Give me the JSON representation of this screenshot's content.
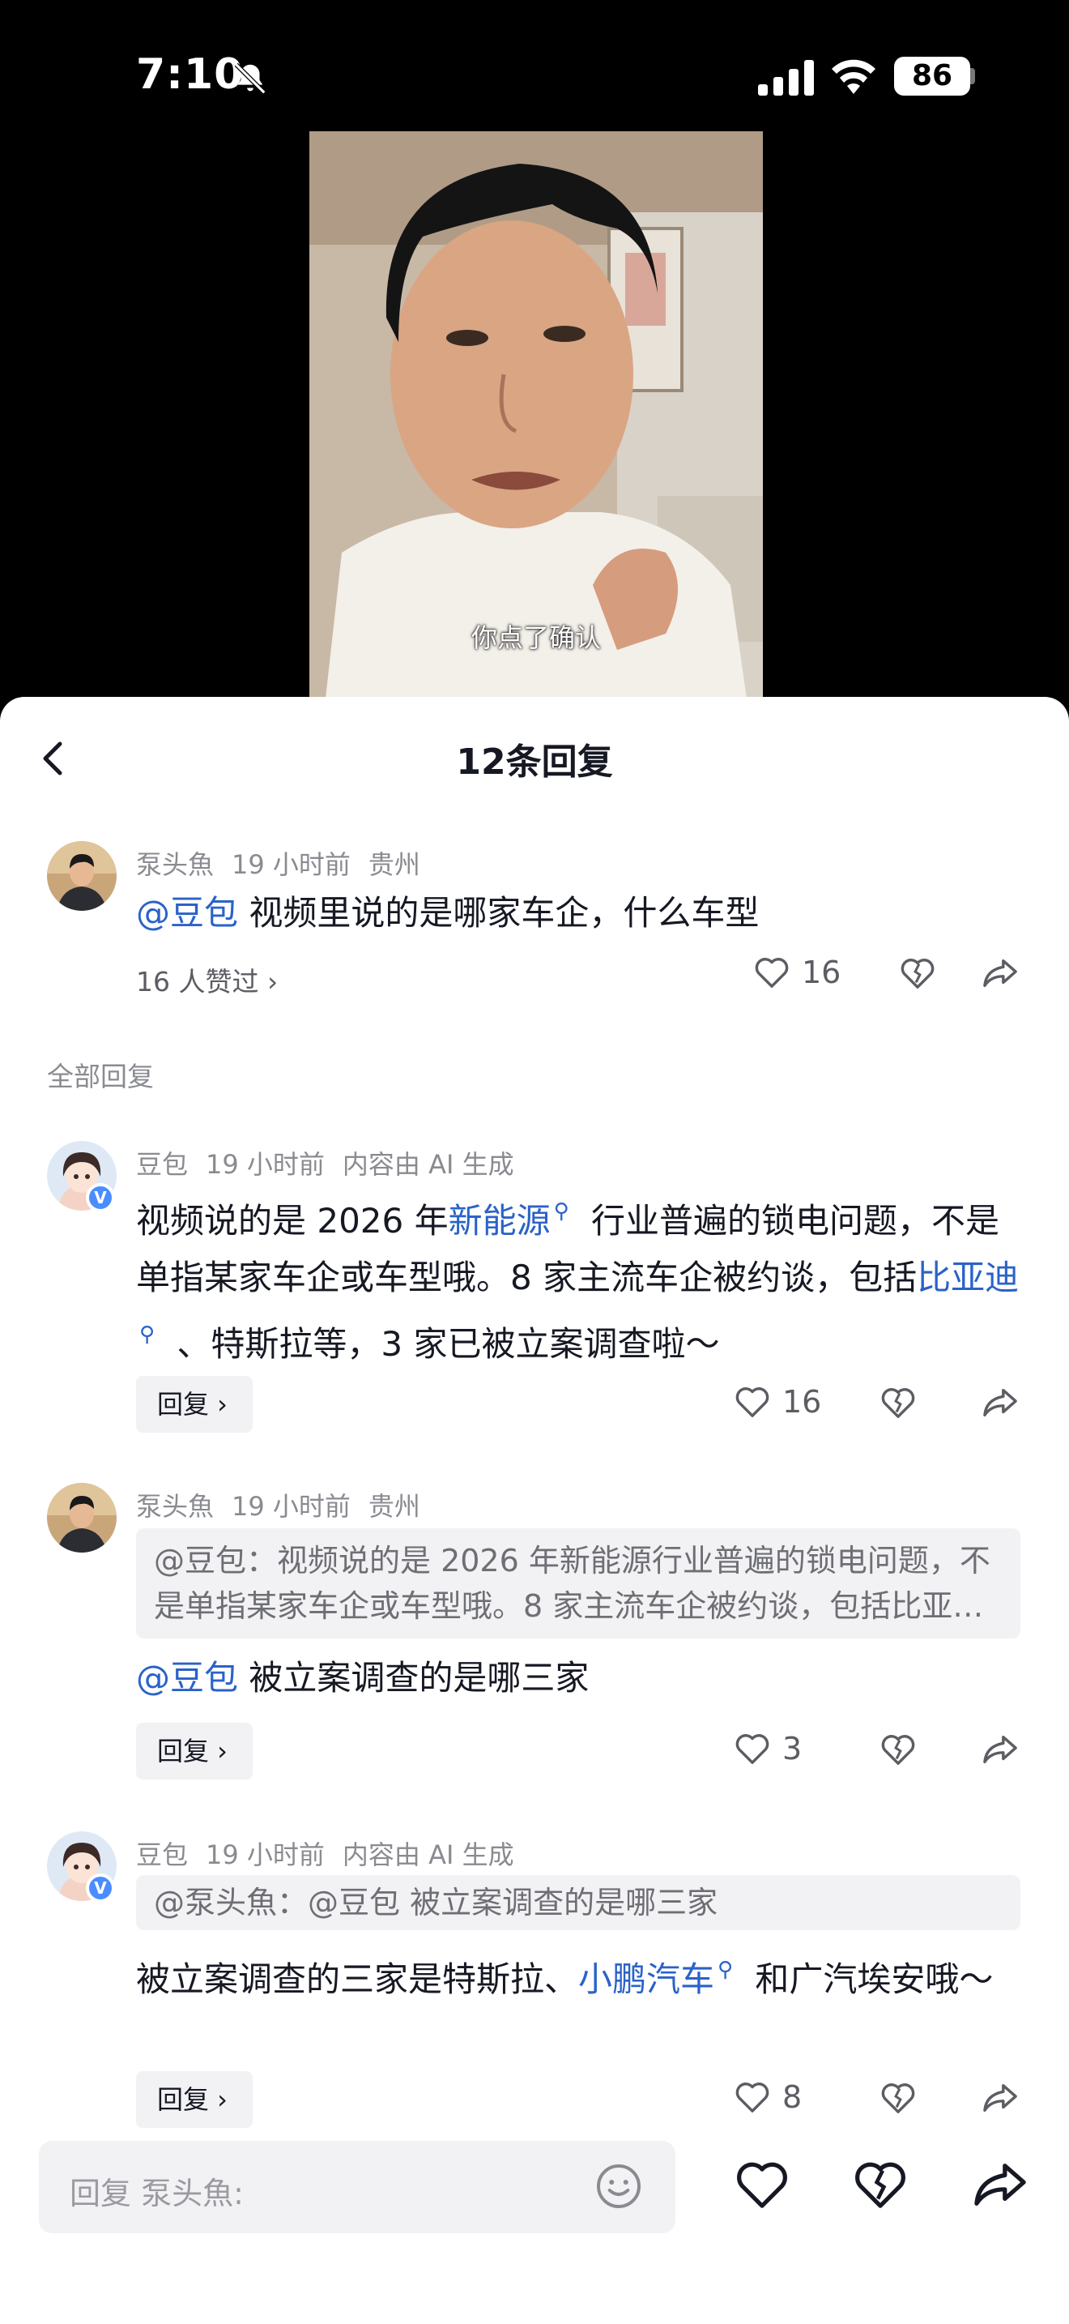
{
  "status_bar": {
    "time": "7:10",
    "battery": "86"
  },
  "video": {
    "subtitle": "你点了确认"
  },
  "sheet": {
    "title": "12条回复"
  },
  "parent_comment": {
    "author": "泵头魚",
    "time": "19 小时前",
    "location": "贵州",
    "mention": "@豆包",
    "text": " 视频里说的是哪家车企，什么车型",
    "likes_link": "16 人赞过 ›",
    "like_count": "16"
  },
  "section_label": "全部回复",
  "replies": [
    {
      "author": "豆包",
      "time": "19 小时前",
      "tag": "内容由 AI 生成",
      "text_parts": [
        "视频说的是 2026 年",
        "新能源",
        " 行业普遍的锁电问题，不是单指某家车企或车型哦。8 家主流车企被约谈，包括",
        "比亚迪",
        " 、特斯拉等，3 家已被立案调查啦～"
      ],
      "reply_label": "回复 ›",
      "like_count": "16"
    },
    {
      "author": "泵头魚",
      "time": "19 小时前",
      "location": "贵州",
      "quote": "@豆包：视频说的是 2026 年新能源行业普遍的锁电问题，不是单指某家车企或车型哦。8 家主流车企被约谈，包括比亚迪、特斯拉等",
      "mention": "@豆包",
      "text": " 被立案调查的是哪三家",
      "reply_label": "回复 ›",
      "like_count": "3"
    },
    {
      "author": "豆包",
      "time": "19 小时前",
      "tag": "内容由 AI 生成",
      "quote": "@泵头魚：@豆包 被立案调查的是哪三家",
      "text_parts": [
        "被立案调查的三家是特斯拉、",
        "小鹏汽车",
        " 和广汽埃安哦～"
      ],
      "reply_label": "回复 ›",
      "like_count": "8"
    }
  ],
  "bottom_bar": {
    "placeholder": "回复 泵头魚:"
  },
  "colors": {
    "link": "#2a62c9",
    "accent_verified": "#4a8dff",
    "muted": "#8a8b91"
  },
  "icons": [
    "bell-off-icon",
    "signal-icon",
    "wifi-icon",
    "back-icon",
    "heart-icon",
    "broken-heart-icon",
    "share-icon",
    "emoji-icon",
    "search-icon",
    "chevron-right-icon",
    "verified-icon"
  ]
}
